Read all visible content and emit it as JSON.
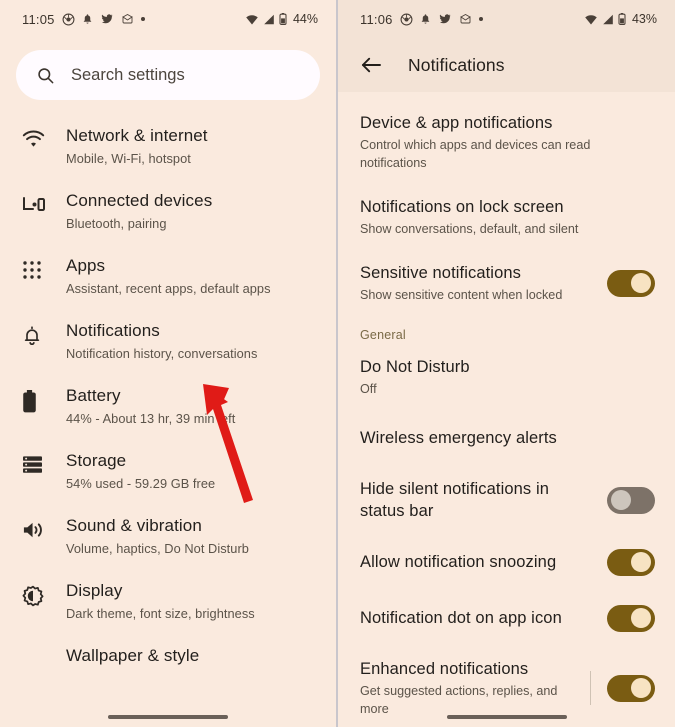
{
  "left_screen": {
    "status_bar": {
      "time": "11:05",
      "battery_percent": "44%",
      "left_icons": [
        "chrome-icon",
        "bell-icon",
        "twitter-icon",
        "mail-icon",
        "more-dot-icon"
      ],
      "right_icons": [
        "wifi-icon",
        "signal-icon",
        "battery-icon"
      ]
    },
    "search": {
      "placeholder": "Search settings",
      "icon": "search-icon"
    },
    "items": [
      {
        "title": "Network & internet",
        "subtitle": "Mobile, Wi-Fi, hotspot",
        "icon": "wifi-icon"
      },
      {
        "title": "Connected devices",
        "subtitle": "Bluetooth, pairing",
        "icon": "devices-icon"
      },
      {
        "title": "Apps",
        "subtitle": "Assistant, recent apps, default apps",
        "icon": "apps-grid-icon"
      },
      {
        "title": "Notifications",
        "subtitle": "Notification history, conversations",
        "icon": "bell-icon"
      },
      {
        "title": "Battery",
        "subtitle": "44% - About 13 hr, 39 min left",
        "icon": "battery-icon"
      },
      {
        "title": "Storage",
        "subtitle": "54% used - 59.29 GB free",
        "icon": "storage-icon"
      },
      {
        "title": "Sound & vibration",
        "subtitle": "Volume, haptics, Do Not Disturb",
        "icon": "volume-icon"
      },
      {
        "title": "Display",
        "subtitle": "Dark theme, font size, brightness",
        "icon": "brightness-icon"
      },
      {
        "title": "Wallpaper & style",
        "subtitle": "",
        "icon": "wallpaper-icon"
      }
    ]
  },
  "right_screen": {
    "status_bar": {
      "time": "11:06",
      "battery_percent": "43%",
      "left_icons": [
        "chrome-icon",
        "bell-icon",
        "twitter-icon",
        "mail-icon",
        "more-dot-icon"
      ],
      "right_icons": [
        "wifi-icon",
        "signal-icon",
        "battery-icon"
      ]
    },
    "toolbar": {
      "title": "Notifications",
      "back_icon": "back-arrow-icon"
    },
    "section_label": "General",
    "items": [
      {
        "title": "Device & app notifications",
        "subtitle": "Control which apps and devices can read notifications",
        "toggle": null
      },
      {
        "title": "Notifications on lock screen",
        "subtitle": "Show conversations, default, and silent",
        "toggle": null
      },
      {
        "title": "Sensitive notifications",
        "subtitle": "Show sensitive content when locked",
        "toggle": "on"
      },
      {
        "title": "Do Not Disturb",
        "subtitle": "Off",
        "toggle": null
      },
      {
        "title": "Wireless emergency alerts",
        "subtitle": "",
        "toggle": null
      },
      {
        "title": "Hide silent notifications in status bar",
        "subtitle": "",
        "toggle": "off"
      },
      {
        "title": "Allow notification snoozing",
        "subtitle": "",
        "toggle": "on"
      },
      {
        "title": "Notification dot on app icon",
        "subtitle": "",
        "toggle": "on"
      },
      {
        "title": "Enhanced notifications",
        "subtitle": "Get suggested actions, replies, and more",
        "toggle": "on",
        "divider": true
      }
    ]
  },
  "annotations": {
    "arrow_color": "#e01b17",
    "arrows": [
      {
        "name": "arrow-to-notifications",
        "target": "Notifications"
      },
      {
        "name": "arrow-to-lock-screen",
        "target": "Notifications on lock screen"
      }
    ]
  },
  "colors": {
    "background": "#faeade",
    "toolbar": "#f3e3d6",
    "search_field": "#fffbff",
    "toggle_on": "#7a5c12",
    "toggle_off": "#7d7268",
    "accent_label": "#7a6a46"
  }
}
